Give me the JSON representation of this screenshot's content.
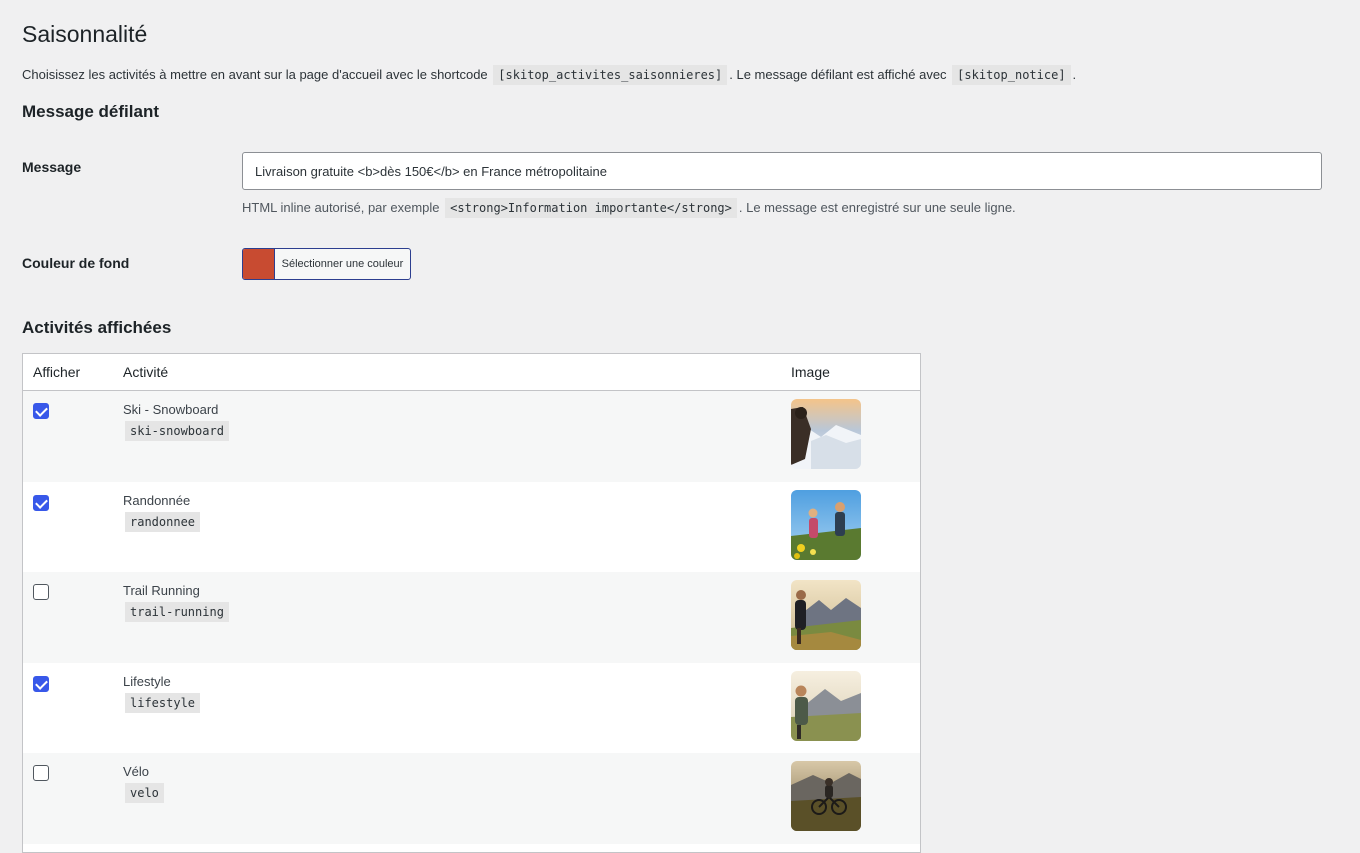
{
  "page": {
    "title": "Saisonnalité",
    "intro_before": "Choisissez les activités à mettre en avant sur la page d'accueil avec le shortcode",
    "intro_code1": "[skitop_activites_saisonnieres]",
    "intro_middle": ". Le message défilant est affiché avec",
    "intro_code2": "[skitop_notice]",
    "intro_after": "."
  },
  "message_section": {
    "heading": "Message défilant",
    "message_label": "Message",
    "message_value": "Livraison gratuite <b>dès 150€</b> en France métropolitaine",
    "desc_before": "HTML inline autorisé, par exemple",
    "desc_code": "<strong>Information importante</strong>",
    "desc_after": ". Le message est enregistré sur une seule ligne.",
    "color_label": "Couleur de fond",
    "color_button_label": "Sélectionner une couleur",
    "color_value": "#c84b31"
  },
  "activities_section": {
    "heading": "Activités affichées",
    "columns": {
      "show": "Afficher",
      "activity": "Activité",
      "image": "Image"
    },
    "rows": [
      {
        "name": "Ski - Snowboard",
        "slug": "ski-snowboard",
        "checked": true,
        "icon": "ski-photo"
      },
      {
        "name": "Randonnée",
        "slug": "randonnee",
        "checked": true,
        "icon": "hiking-photo"
      },
      {
        "name": "Trail Running",
        "slug": "trail-running",
        "checked": false,
        "icon": "trail-running-photo"
      },
      {
        "name": "Lifestyle",
        "slug": "lifestyle",
        "checked": true,
        "icon": "lifestyle-photo"
      },
      {
        "name": "Vélo",
        "slug": "velo",
        "checked": false,
        "icon": "bike-photo"
      }
    ]
  },
  "colors": {
    "accent": "#3858e9",
    "swatch": "#c84b31"
  }
}
